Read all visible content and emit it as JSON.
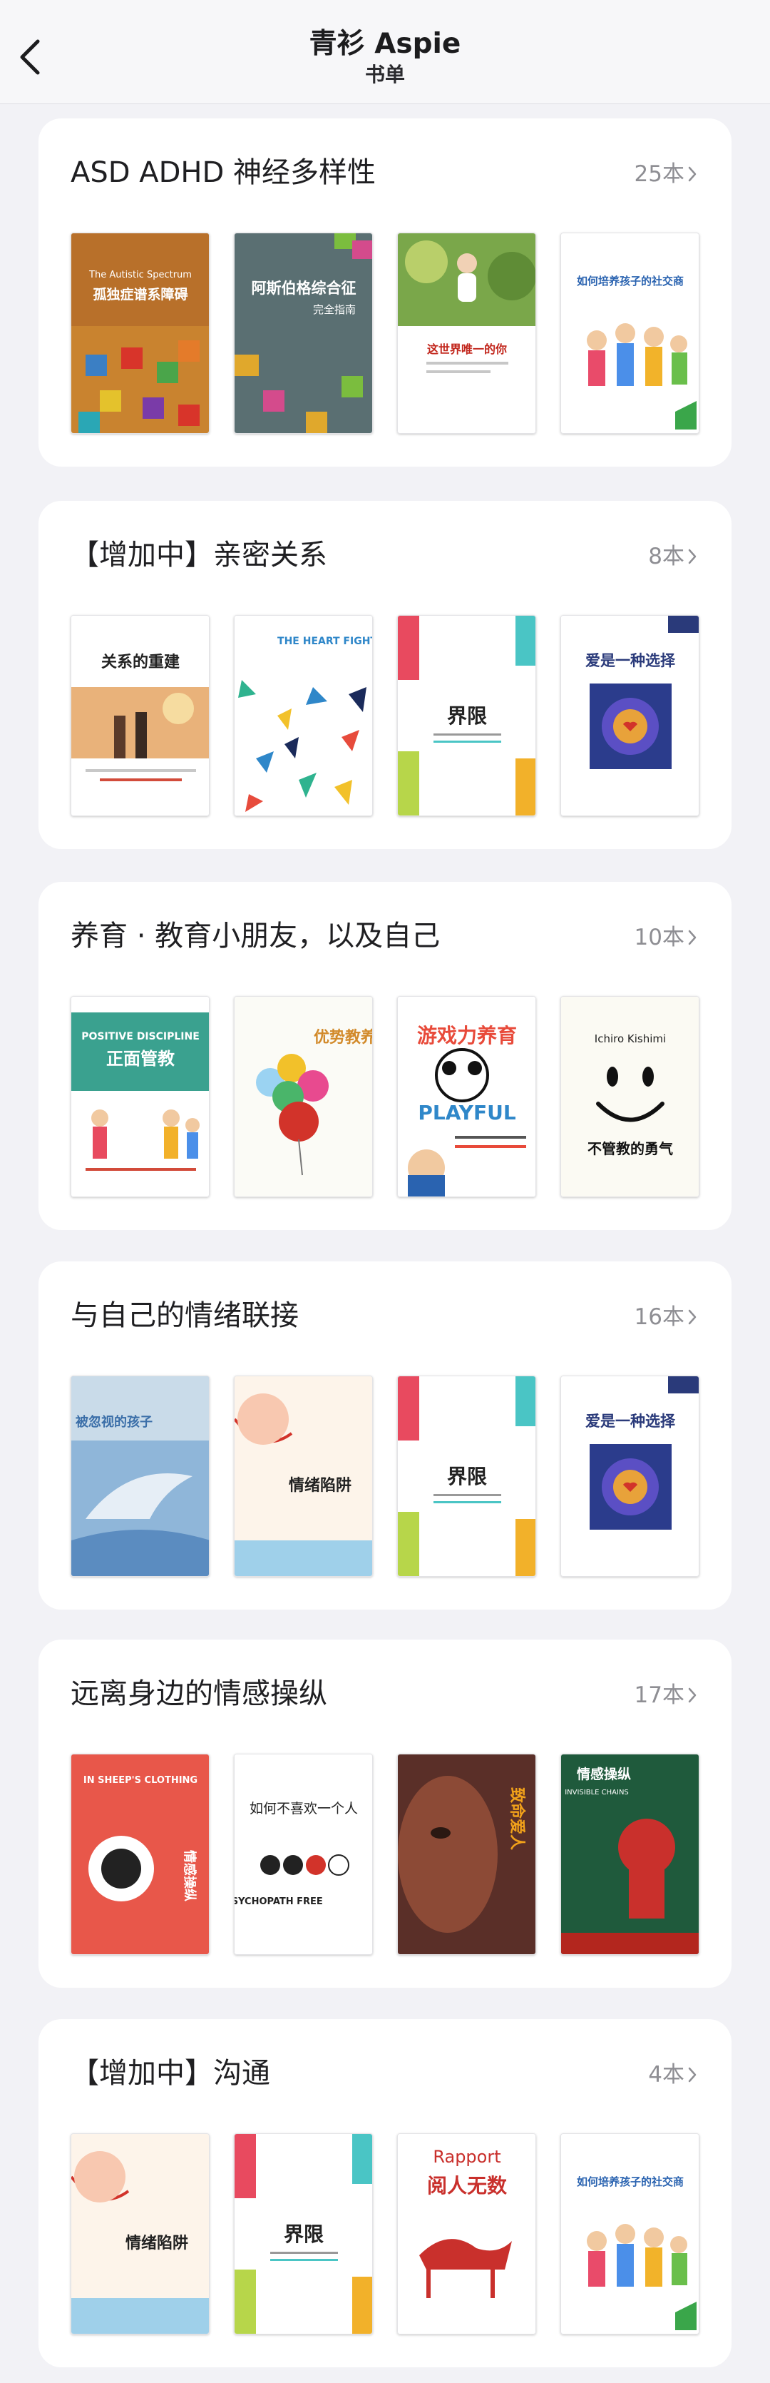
{
  "nav": {
    "title": "青衫 Aspie",
    "subtitle": "书单"
  },
  "icons": {
    "back": "chevron-left-icon",
    "more": "chevron-right-icon"
  },
  "colors": {
    "background": "#f2f2f6",
    "card": "#ffffff",
    "count_text": "#8e8e93"
  },
  "sections": [
    {
      "title": "ASD ADHD 神经多样性",
      "count": "25本",
      "books": [
        {
          "title": "孤独症谱系障碍",
          "subtitle": "The Autistic Spectrum"
        },
        {
          "title": "阿斯伯格综合征",
          "subtitle": "完全指南"
        },
        {
          "title": "这世界唯一的你"
        },
        {
          "title": "如何培养孩子的社交商"
        }
      ]
    },
    {
      "title": "【增加中】亲密关系",
      "count": "8本",
      "books": [
        {
          "title": "关系的重建"
        },
        {
          "title": "THE HEART FIGHT"
        },
        {
          "title": "界限"
        },
        {
          "title": "爱是一种选择"
        }
      ]
    },
    {
      "title": "养育 · 教育小朋友，以及自己",
      "count": "10本",
      "books": [
        {
          "title": "正面管教",
          "subtitle": "POSITIVE DISCIPLINE"
        },
        {
          "title": "优势教养"
        },
        {
          "title": "游戏力养育",
          "subtitle": "PLAYFUL"
        },
        {
          "title": "不管教的勇气",
          "subtitle": "Ichiro Kishimi"
        }
      ]
    },
    {
      "title": "与自己的情绪联接",
      "count": "16本",
      "books": [
        {
          "title": "被忽视的孩子"
        },
        {
          "title": "情绪陷阱"
        },
        {
          "title": "界限"
        },
        {
          "title": "爱是一种选择"
        }
      ]
    },
    {
      "title": "远离身边的情感操纵",
      "count": "17本",
      "books": [
        {
          "title": "情感操纵",
          "subtitle": "IN SHEEP'S CLOTHING"
        },
        {
          "title": "如何不喜欢一个人",
          "subtitle": "PSYCHOPATH FREE"
        },
        {
          "title": "致命爱人"
        },
        {
          "title": "情感操纵",
          "subtitle": "INVISIBLE CHAINS"
        }
      ]
    },
    {
      "title": "【增加中】沟通",
      "count": "4本",
      "books": [
        {
          "title": "情绪陷阱"
        },
        {
          "title": "界限"
        },
        {
          "title": "阅人无数",
          "subtitle": "Rapport"
        },
        {
          "title": "如何培养孩子的社交商"
        }
      ]
    }
  ]
}
